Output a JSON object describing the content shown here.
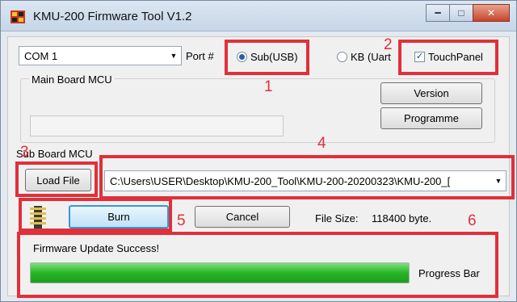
{
  "window": {
    "title": "KMU-200 Firmware Tool V1.2"
  },
  "port": {
    "selected": "COM 1",
    "label": "Port #"
  },
  "mode": {
    "sub_usb_label": "Sub(USB)",
    "sub_usb_selected": true,
    "kb_uart_label": "KB (Uart",
    "kb_uart_selected": false
  },
  "touchpanel": {
    "label": "TouchPanel",
    "checked": true
  },
  "main_board": {
    "title": "Main Board MCU",
    "version_label": "Version",
    "programme_label": "Programme"
  },
  "sub_board": {
    "title": "Sub Board MCU",
    "load_file_label": "Load File",
    "file_path": "C:\\Users\\USER\\Desktop\\KMU-200_Tool\\KMU-200-20200323\\KMU-200_["
  },
  "actions": {
    "burn_label": "Burn",
    "cancel_label": "Cancel",
    "file_size_label": "File Size:",
    "file_size_value": "118400 byte."
  },
  "status": {
    "message": "Firmware Update Success!",
    "progress_label": "Progress Bar",
    "progress_fraction": 1.0
  },
  "annotations": [
    "1",
    "2",
    "3",
    "4",
    "5",
    "6"
  ],
  "colors": {
    "annotation": "#e0303a",
    "progress": "#26b526",
    "focus": "#3c95d8"
  }
}
